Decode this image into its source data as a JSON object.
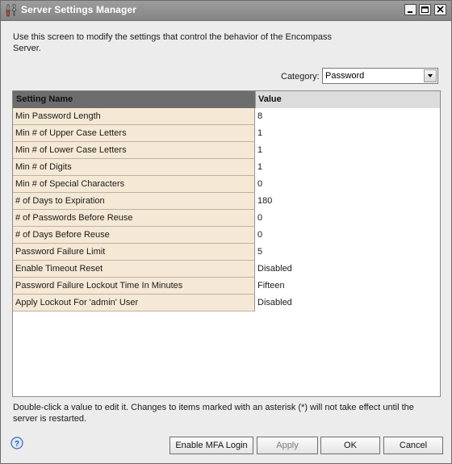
{
  "window": {
    "title": "Server Settings Manager"
  },
  "description": "Use this screen to modify the settings that control the behavior of the Encompass Server.",
  "category": {
    "label": "Category:",
    "value": "Password"
  },
  "table": {
    "headers": [
      "Setting Name",
      "Value"
    ],
    "rows": [
      {
        "name": "Min Password Length",
        "value": "8"
      },
      {
        "name": "Min # of Upper Case Letters",
        "value": "1"
      },
      {
        "name": "Min # of Lower Case Letters",
        "value": "1"
      },
      {
        "name": "Min # of Digits",
        "value": "1"
      },
      {
        "name": "Min # of Special Characters",
        "value": "0"
      },
      {
        "name": "# of Days to Expiration",
        "value": "180"
      },
      {
        "name": "# of Passwords Before Reuse",
        "value": "0"
      },
      {
        "name": "# of Days Before Reuse",
        "value": "0"
      },
      {
        "name": "Password Failure Limit",
        "value": "5"
      },
      {
        "name": "Enable Timeout Reset",
        "value": "Disabled"
      },
      {
        "name": "Password Failure Lockout Time In Minutes",
        "value": "Fifteen"
      },
      {
        "name": "Apply Lockout For 'admin' User",
        "value": "Disabled"
      }
    ]
  },
  "hint": "Double-click a value to edit it. Changes to items marked with an asterisk (*) will not take effect until the server is restarted.",
  "buttons": {
    "mfa": "Enable MFA Login",
    "apply": "Apply",
    "ok": "OK",
    "cancel": "Cancel"
  },
  "icons": {
    "app": "tools-icon",
    "help": "help-icon",
    "minimize": "minimize-icon",
    "maximize": "maximize-icon",
    "close": "close-icon",
    "dropdown": "chevron-down-icon"
  }
}
